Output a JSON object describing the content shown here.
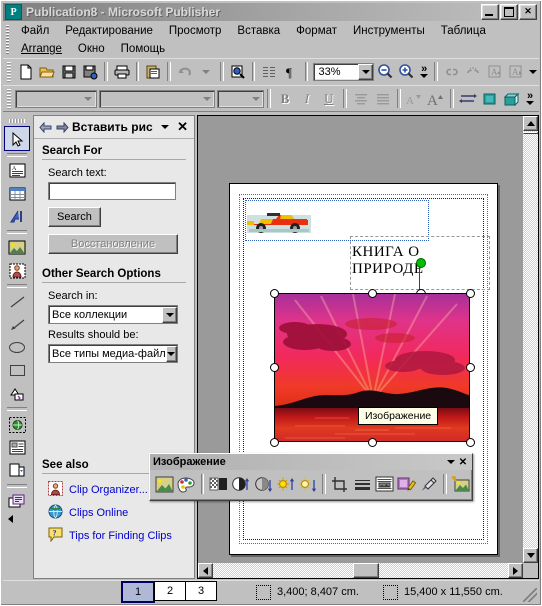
{
  "window": {
    "title": "Publication8 - Microsoft Publisher",
    "app_icon": "publisher-icon",
    "minimize": "minimize-icon",
    "maximize": "maximize-icon",
    "close": "close-icon"
  },
  "menubar": {
    "row1": [
      "Файл",
      "Редактирование",
      "Просмотр",
      "Вставка",
      "Формат",
      "Инструменты",
      "Таблица"
    ],
    "row2": [
      "Arrange",
      "Окно",
      "Помощь"
    ]
  },
  "toolbar_standard": {
    "buttons": [
      "new-document-icon",
      "open-folder-icon",
      "save-icon",
      "save-as-web-icon",
      "print-icon",
      "paste-icon",
      "undo-icon",
      "undo-dropdown-icon",
      "design-checker-icon",
      "text-columns-icon",
      "paragraph-marks-icon"
    ],
    "zoom_value": "33%",
    "zoom_out": "zoom-out-icon",
    "zoom_in": "zoom-in-icon",
    "overflow": "toolbar-overflow-icon",
    "right_buttons": [
      "link-text-boxes-icon",
      "unlink-text-boxes-icon",
      "previous-textbox-icon",
      "next-textbox-icon"
    ]
  },
  "toolbar_format": {
    "style_value": "",
    "font_value": "",
    "size_value": "",
    "bold": "B",
    "italic": "I",
    "underline": "U",
    "align_center": "align-center-icon",
    "align_justify": "align-justify-icon",
    "font_shrink": "decrease-font-icon",
    "font_grow": "increase-font-icon",
    "char_spacing": "character-spacing-icon",
    "fill_color": "fill-color-icon",
    "shadow_3d": "3d-effects-icon",
    "overflow": "toolbar-overflow-icon"
  },
  "objects_toolbar": {
    "items": [
      {
        "name": "select-objects-tool",
        "selected": true
      },
      {
        "name": "text-box-tool",
        "selected": false
      },
      {
        "name": "insert-table-tool",
        "selected": false
      },
      {
        "name": "wordart-tool",
        "selected": false
      },
      {
        "name": "picture-frame-tool",
        "selected": false
      },
      {
        "name": "clip-organizer-frame-tool",
        "selected": false
      },
      {
        "name": "line-tool",
        "selected": false
      },
      {
        "name": "arrow-tool",
        "selected": false
      },
      {
        "name": "oval-tool",
        "selected": false
      },
      {
        "name": "rectangle-tool",
        "selected": false
      },
      {
        "name": "autoshapes-tool",
        "selected": false
      },
      {
        "name": "hot-spot-tool",
        "selected": false
      },
      {
        "name": "form-control-tool",
        "selected": false
      },
      {
        "name": "html-code-fragment-tool",
        "selected": false
      },
      {
        "name": "design-gallery-object-tool",
        "selected": false
      }
    ]
  },
  "taskpane": {
    "title": "Вставить рис",
    "back_icon": "back-arrow-icon",
    "forward_icon": "forward-arrow-icon",
    "dropdown_icon": "chevron-down-icon",
    "close_icon": "close-icon",
    "search_for_heading": "Search For",
    "search_text_label": "Search text:",
    "search_input_value": "",
    "search_button": "Search",
    "restore_button": "Восстановление",
    "other_options_heading": "Other Search Options",
    "search_in_label": "Search in:",
    "search_in_value": "Все коллекции",
    "results_label": "Results should be:",
    "results_value": "Все типы медиа-файл",
    "see_also_heading": "See also",
    "links": [
      {
        "label": "Clip Organizer...",
        "icon": "clip-organizer-icon"
      },
      {
        "label": "Clips Online",
        "icon": "globe-icon"
      },
      {
        "label": "Tips for Finding Clips",
        "icon": "help-balloon-icon"
      }
    ]
  },
  "document": {
    "title_text_line1": "КНИГА О",
    "title_text_line2": "ПРИРОДЕ",
    "clipart_name": "race-car-clipart",
    "picture_name": "sunset-photo",
    "picture_tooltip": "Изображение"
  },
  "picture_toolbar": {
    "title": "Изображение",
    "dropdown_icon": "chevron-down-icon",
    "close_icon": "close-icon",
    "buttons": [
      "insert-picture-icon",
      "color-icon",
      "more-contrast-icon",
      "less-contrast-icon",
      "more-brightness-icon",
      "less-brightness-icon",
      "crop-icon",
      "line-style-icon",
      "text-wrapping-icon",
      "format-picture-icon",
      "set-transparent-color-icon",
      "reset-picture-icon"
    ]
  },
  "statusbar": {
    "pages": [
      "1",
      "2",
      "3"
    ],
    "active_page": "1",
    "position_icon": "object-position-icon",
    "position": "3,400; 8,407 cm.",
    "size_icon": "object-size-icon",
    "size": "15,400 x  11,550 cm."
  },
  "colors": {
    "window_face": "#c0c0c0",
    "titlebar_start": "#808080",
    "accent_teal": "#008080",
    "link_blue": "#0000cc",
    "margin_guide": "#ff00ff",
    "blue_guide": "#0000ff",
    "selection_green": "#00c000"
  }
}
